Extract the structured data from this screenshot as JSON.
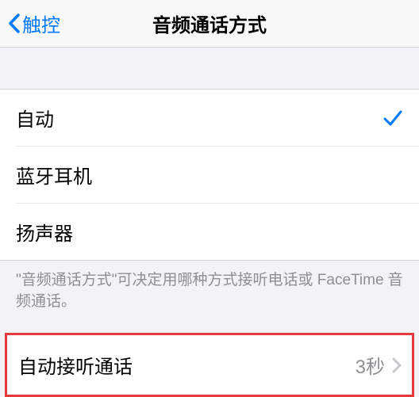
{
  "nav": {
    "back_label": "触控",
    "title": "音频通话方式"
  },
  "options": {
    "auto": "自动",
    "bluetooth": "蓝牙耳机",
    "speaker": "扬声器"
  },
  "footer": "\"音频通话方式\"可决定用哪种方式接听电话或 FaceTime 音频通话。",
  "auto_answer": {
    "label": "自动接听通话",
    "value": "3秒"
  }
}
